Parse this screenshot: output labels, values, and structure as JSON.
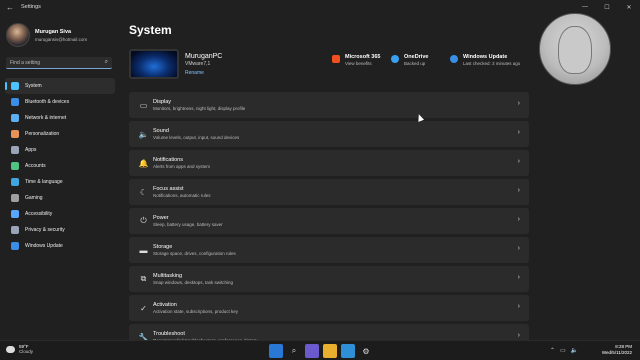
{
  "window": {
    "title": "Settings",
    "controls": [
      "—",
      "☐",
      "✕"
    ]
  },
  "profile": {
    "name": "Murugan Siva",
    "email": "murugansiv@hotmail.com"
  },
  "search": {
    "placeholder": "Find a setting"
  },
  "nav": [
    {
      "label": "System",
      "icon": "system-icon",
      "color": "#4cc2ff",
      "active": true
    },
    {
      "label": "Bluetooth & devices",
      "icon": "bluetooth-icon",
      "color": "#3b8ee8"
    },
    {
      "label": "Network & internet",
      "icon": "network-icon",
      "color": "#5ab0f2"
    },
    {
      "label": "Personalization",
      "icon": "brush-icon",
      "color": "#e8925a"
    },
    {
      "label": "Apps",
      "icon": "apps-icon",
      "color": "#9aa6b8"
    },
    {
      "label": "Accounts",
      "icon": "accounts-icon",
      "color": "#4fc37f"
    },
    {
      "label": "Time & language",
      "icon": "globe-icon",
      "color": "#3fa7e0"
    },
    {
      "label": "Gaming",
      "icon": "gaming-icon",
      "color": "#a0a0a0"
    },
    {
      "label": "Accessibility",
      "icon": "accessibility-icon",
      "color": "#58a6ff"
    },
    {
      "label": "Privacy & security",
      "icon": "shield-icon",
      "color": "#9aa6b8"
    },
    {
      "label": "Windows Update",
      "icon": "update-icon",
      "color": "#3b8ee8"
    }
  ],
  "page": {
    "title": "System"
  },
  "device": {
    "name": "MuruganPC",
    "model": "VMware7,1",
    "rename": "Rename"
  },
  "quick": [
    {
      "title": "Microsoft 365",
      "sub": "View benefits",
      "icon": "microsoft-365-icon",
      "color": "#f25022"
    },
    {
      "title": "OneDrive",
      "sub": "Backed up",
      "icon": "onedrive-icon",
      "color": "#3aa0f0"
    },
    {
      "title": "Windows Update",
      "sub": "Last checked: 3 minutes ago",
      "icon": "windows-update-icon",
      "color": "#3b8ee8"
    }
  ],
  "cards": [
    {
      "title": "Display",
      "sub": "Monitors, brightness, night light, display profile",
      "icon": "display-icon",
      "glyph": "▭"
    },
    {
      "title": "Sound",
      "sub": "Volume levels, output, input, sound devices",
      "icon": "speaker-icon",
      "glyph": "🔈"
    },
    {
      "title": "Notifications",
      "sub": "Alerts from apps and system",
      "icon": "bell-icon",
      "glyph": "🔔"
    },
    {
      "title": "Focus assist",
      "sub": "Notifications, automatic rules",
      "icon": "moon-icon",
      "glyph": "☾"
    },
    {
      "title": "Power",
      "sub": "Sleep, battery usage, battery saver",
      "icon": "power-icon",
      "glyph": "⏻"
    },
    {
      "title": "Storage",
      "sub": "Storage space, drives, configuration rules",
      "icon": "storage-icon",
      "glyph": "▬"
    },
    {
      "title": "Multitasking",
      "sub": "Snap windows, desktops, task switching",
      "icon": "multitasking-icon",
      "glyph": "⧉"
    },
    {
      "title": "Activation",
      "sub": "Activation state, subscriptions, product key",
      "icon": "activation-icon",
      "glyph": "✓"
    },
    {
      "title": "Troubleshoot",
      "sub": "Recommended troubleshooters, preferences, history",
      "icon": "wrench-icon",
      "glyph": "🔧"
    }
  ],
  "taskbar": {
    "weather_temp": "59°F",
    "weather_cond": "Cloudy",
    "time": "8:28 PM",
    "date": "Wed/5/11/2022"
  }
}
